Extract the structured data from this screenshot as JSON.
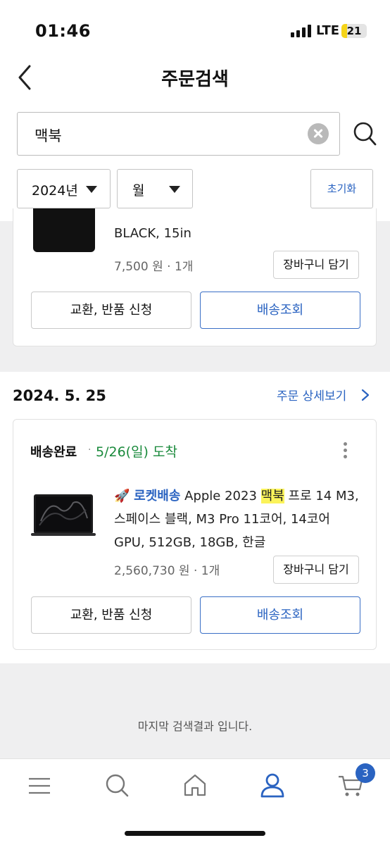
{
  "status_bar": {
    "time": "01:46",
    "network": "LTE",
    "battery": "21",
    "battery_level": 0.21,
    "colors": {
      "battery": "#f5d419"
    }
  },
  "header": {
    "title": "주문검색",
    "back_icon": "chevron-left-icon"
  },
  "search": {
    "query": "맥북",
    "clear_icon": "clear-icon",
    "search_icon": "search-icon"
  },
  "filters": {
    "year": "2024년",
    "month": "월",
    "reset_label": "초기화"
  },
  "orders": [
    {
      "product_name_tail": "BLACK, 15in",
      "price": "7,500 원",
      "quantity": "1개",
      "cart_add_label": "장바구니 담기",
      "exchange_label": "교환, 반품 신청",
      "track_label": "배송조회"
    },
    {
      "date": "2024. 5. 25",
      "detail_link": "주문 상세보기",
      "status": "배송완료",
      "arrival": "5/26(일) 도착",
      "rocket_label": "로켓배송",
      "product_name_pre": "Apple 2023",
      "product_name_highlight": "맥북",
      "product_name_post": "프로 14 M3, 스페이스 블랙, M3 Pro 11코어, 14코어 GPU, 512GB, 18GB, 한글",
      "price": "2,560,730 원",
      "quantity": "1개",
      "cart_add_label": "장바구니 담기",
      "exchange_label": "교환, 반품 신청",
      "track_label": "배송조회"
    }
  ],
  "end_message": "마지막 검색결과 입니다.",
  "bottom_nav": {
    "items": [
      "menu-icon",
      "search-icon",
      "home-icon",
      "user-icon",
      "cart-icon"
    ],
    "cart_badge": "3"
  },
  "colors": {
    "accent": "#2a63c1",
    "arrival_green": "#1a8a3c",
    "highlight": "#fbf35a"
  }
}
